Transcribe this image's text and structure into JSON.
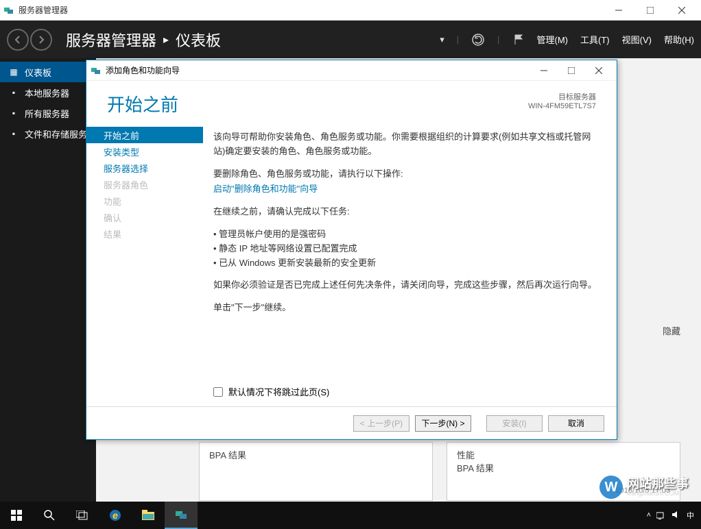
{
  "app": {
    "title": "服务器管理器"
  },
  "header": {
    "breadcrumb": {
      "root": "服务器管理器",
      "current": "仪表板"
    },
    "menus": {
      "manage": "管理(M)",
      "tools": "工具(T)",
      "view": "视图(V)",
      "help": "帮助(H)"
    }
  },
  "sidebar": {
    "items": [
      {
        "label": "仪表板",
        "active": true
      },
      {
        "label": "本地服务器",
        "active": false
      },
      {
        "label": "所有服务器",
        "active": false
      },
      {
        "label": "文件和存储服务",
        "active": false
      }
    ]
  },
  "hidden_btn": "隐藏",
  "modal": {
    "title": "添加角色和功能向导",
    "heading": "开始之前",
    "target": {
      "label": "目标服务器",
      "name": "WIN-4FM59ETL7S7"
    },
    "nav": [
      {
        "label": "开始之前",
        "state": "active"
      },
      {
        "label": "安装类型",
        "state": "enabled"
      },
      {
        "label": "服务器选择",
        "state": "enabled"
      },
      {
        "label": "服务器角色",
        "state": "disabled"
      },
      {
        "label": "功能",
        "state": "disabled"
      },
      {
        "label": "确认",
        "state": "disabled"
      },
      {
        "label": "结果",
        "state": "disabled"
      }
    ],
    "content": {
      "p1": "该向导可帮助你安装角色、角色服务或功能。你需要根据组织的计算要求(例如共享文档或托管网站)确定要安装的角色、角色服务或功能。",
      "p2": "要删除角色、角色服务或功能，请执行以下操作:",
      "link": "启动\"删除角色和功能\"向导",
      "p3": "在继续之前，请确认完成以下任务:",
      "bullets": [
        "管理员帐户使用的是强密码",
        "静态 IP 地址等网络设置已配置完成",
        "已从 Windows 更新安装最新的安全更新"
      ],
      "p4": "如果你必须验证是否已完成上述任何先决条件，请关闭向导，完成这些步骤，然后再次运行向导。",
      "p5": "单击\"下一步\"继续。"
    },
    "skip": "默认情况下将跳过此页(S)",
    "buttons": {
      "prev": "< 上一步(P)",
      "next": "下一步(N) >",
      "install": "安装(I)",
      "cancel": "取消"
    }
  },
  "bg": {
    "panel1": {
      "line1": "BPA 结果"
    },
    "panel2": {
      "line1": "性能",
      "line2": "BPA 结果",
      "date": "2018/10/5 17:03"
    }
  },
  "watermark": {
    "text": "网站那些事",
    "sub": "wangzhanshi.COM"
  }
}
